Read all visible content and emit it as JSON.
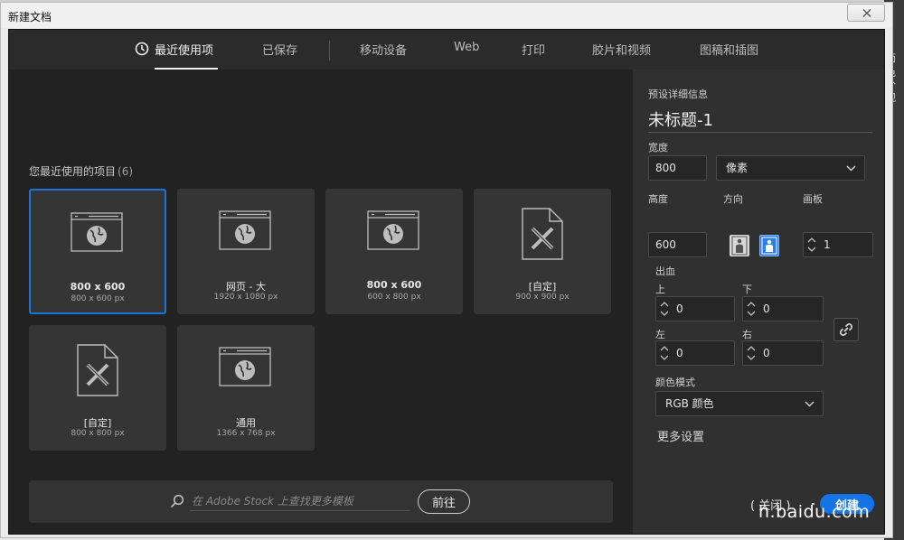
{
  "window": {
    "title": "新建文档"
  },
  "background_app": {
    "labels": [
      "面色",
      "外观"
    ]
  },
  "tabs": [
    {
      "label": "最近使用项",
      "active": true
    },
    {
      "label": "已保存"
    },
    {
      "label": "移动设备"
    },
    {
      "label": "Web"
    },
    {
      "label": "打印"
    },
    {
      "label": "胶片和视频"
    },
    {
      "label": "图稿和插图"
    }
  ],
  "recent": {
    "title": "您最近使用的项目",
    "count": "(6)",
    "items": [
      {
        "name": "800 x 600",
        "size": "800 x 600 px",
        "icon": "web-globe-icon",
        "selected": true
      },
      {
        "name": "网页 - 大",
        "size": "1920 x 1080 px",
        "icon": "web-globe-icon"
      },
      {
        "name": "800 x 600",
        "size": "600 x 800 px",
        "icon": "web-globe-icon"
      },
      {
        "name": "[自定]",
        "size": "900 x 900 px",
        "icon": "custom-document-icon"
      },
      {
        "name": "[自定]",
        "size": "800 x 800 px",
        "icon": "custom-document-icon"
      },
      {
        "name": "通用",
        "size": "1366 x 768 px",
        "icon": "web-globe-icon"
      }
    ]
  },
  "stock": {
    "placeholder": "在 Adobe Stock 上查找更多模板",
    "go_label": "前往"
  },
  "preset": {
    "header": "预设详细信息",
    "name": "未标题-1",
    "width_label": "宽度",
    "width_value": "800",
    "unit": "像素",
    "height_label": "高度",
    "height_value": "600",
    "orientation_label": "方向",
    "artboard_label": "画板",
    "artboard_value": "1",
    "bleed_label": "出血",
    "bleed_top_label": "上",
    "bleed_top": "0",
    "bleed_bottom_label": "下",
    "bleed_bottom": "0",
    "bleed_left_label": "左",
    "bleed_left": "0",
    "bleed_right_label": "右",
    "bleed_right": "0",
    "color_mode_label": "颜色模式",
    "color_mode": "RGB 颜色",
    "more_settings": "更多设置"
  },
  "footer": {
    "close_label": "关闭",
    "create_label": "创建"
  },
  "watermark": "h.baidu.com",
  "colors": {
    "accent": "#1473e6",
    "selected_border": "#1e73d9",
    "dialog_bg": "#222222",
    "panel_bg": "#303030"
  }
}
